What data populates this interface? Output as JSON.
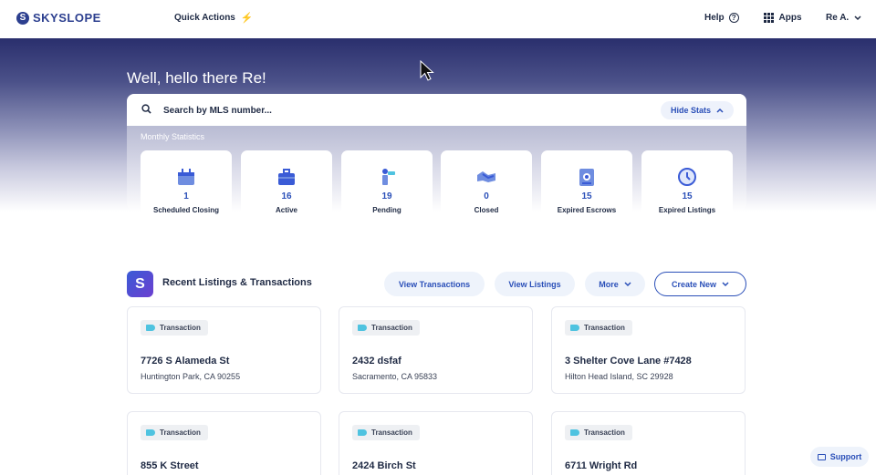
{
  "topbar": {
    "logo_text": "SKYSLOPE",
    "quick_actions": "Quick Actions",
    "help": "Help",
    "apps": "Apps",
    "user": "Re A."
  },
  "hero": {
    "greeting": "Well, hello there Re!",
    "search_placeholder": "Search by MLS number...",
    "hide_stats": "Hide Stats",
    "monthly_label": "Monthly Statistics"
  },
  "stats": [
    {
      "value": "1",
      "label": "Scheduled Closing",
      "icon": "calendar-icon"
    },
    {
      "value": "16",
      "label": "Active",
      "icon": "briefcase-icon"
    },
    {
      "value": "19",
      "label": "Pending",
      "icon": "pending-icon"
    },
    {
      "value": "0",
      "label": "Closed",
      "icon": "handshake-icon"
    },
    {
      "value": "15",
      "label": "Expired Escrows",
      "icon": "document-icon"
    },
    {
      "value": "15",
      "label": "Expired Listings",
      "icon": "clock-icon"
    }
  ],
  "section": {
    "title": "Recent Listings & Transactions",
    "view_transactions": "View Transactions",
    "view_listings": "View Listings",
    "more": "More",
    "create_new": "Create New"
  },
  "listings": [
    {
      "tag": "Transaction",
      "address": "7726 S Alameda St",
      "city": "Huntington Park, CA 90255"
    },
    {
      "tag": "Transaction",
      "address": "2432 dsfaf",
      "city": "Sacramento, CA 95833"
    },
    {
      "tag": "Transaction",
      "address": "3 Shelter Cove Lane #7428",
      "city": "Hilton Head Island, SC 29928"
    },
    {
      "tag": "Transaction",
      "address": "855 K Street",
      "city": ""
    },
    {
      "tag": "Transaction",
      "address": "2424 Birch St",
      "city": ""
    },
    {
      "tag": "Transaction",
      "address": "6711 Wright Rd",
      "city": ""
    }
  ],
  "support": "Support",
  "colors": {
    "accent": "#2a4fb8",
    "hero_top": "#2a2f6d",
    "tag_icon": "#4fc3e0"
  }
}
